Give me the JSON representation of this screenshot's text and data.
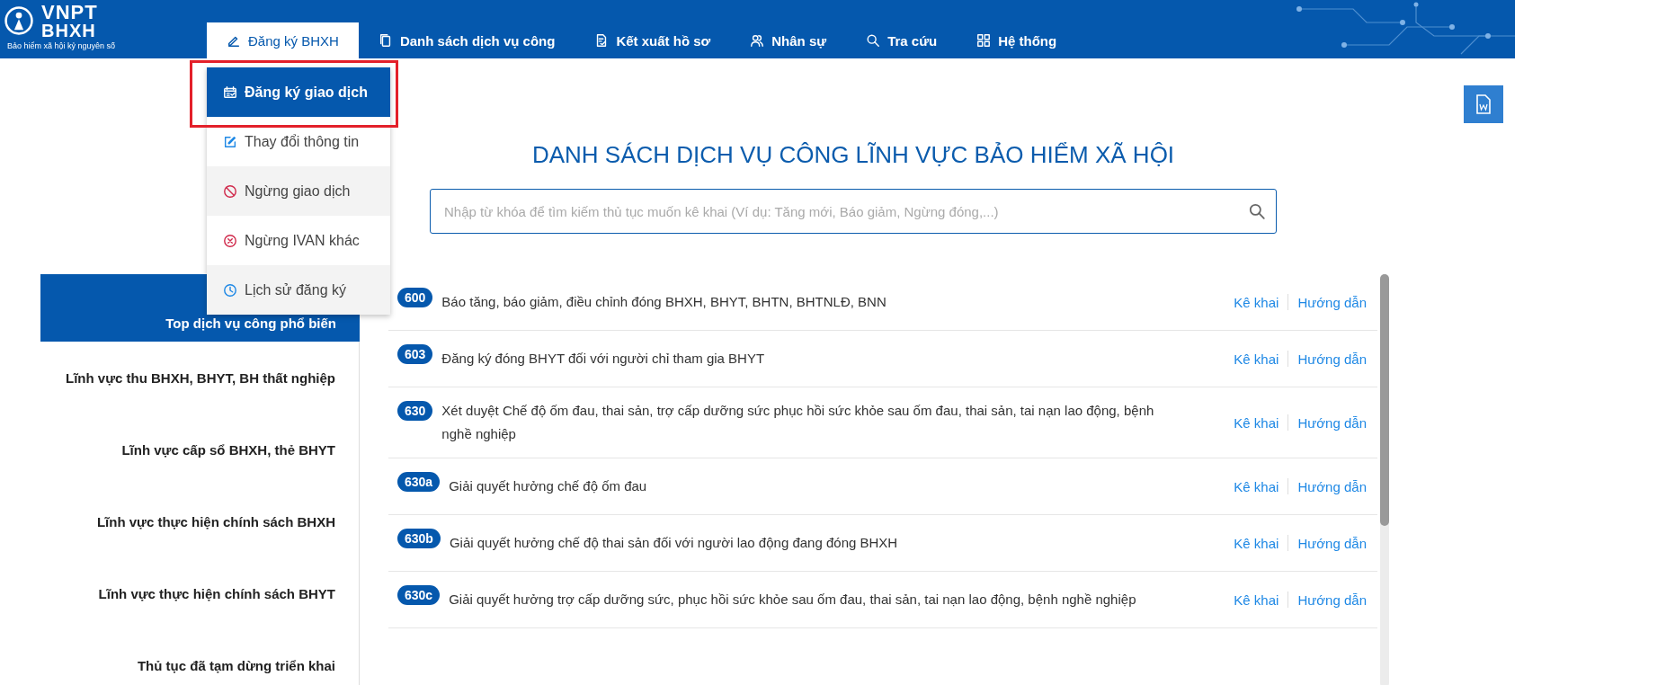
{
  "logo": {
    "brand": "VNPT",
    "product": "BHXH",
    "tagline": "Bảo hiểm xã hội kỷ nguyên số"
  },
  "nav": [
    {
      "label": "Đăng ký BHXH",
      "kind": "pencil",
      "selected": true
    },
    {
      "label": "Danh sách dịch vụ công",
      "kind": "copy",
      "selected": false
    },
    {
      "label": "Kết xuất hồ sơ",
      "kind": "file",
      "selected": false
    },
    {
      "label": "Nhân sự",
      "kind": "users",
      "selected": false
    },
    {
      "label": "Tra cứu",
      "kind": "search",
      "selected": false
    },
    {
      "label": "Hệ thống",
      "kind": "grid",
      "selected": false
    }
  ],
  "dropdown": [
    {
      "label": "Đăng ký giao dịch",
      "kind": "calendar",
      "selected": true,
      "highlighted": true
    },
    {
      "label": "Thay đổi thông tin",
      "kind": "edit",
      "selected": false,
      "highlighted": false
    },
    {
      "label": "Ngừng giao dịch",
      "kind": "ban",
      "selected": false,
      "highlighted": false
    },
    {
      "label": "Ngừng IVAN khác",
      "kind": "x-circle",
      "selected": false,
      "highlighted": false
    },
    {
      "label": "Lịch sử đăng ký",
      "kind": "clock",
      "selected": false,
      "highlighted": false
    }
  ],
  "title": "DANH SÁCH DỊCH VỤ CÔNG LĨNH VỰC BẢO HIỂM XÃ HỘI",
  "search": {
    "placeholder": "Nhập từ khóa để tìm kiếm thủ tục muốn kê khai (Ví dụ: Tăng mới, Báo giảm, Ngừng đóng,...)"
  },
  "sidebar": [
    {
      "label": "Top dịch vụ công phổ biến",
      "selected": true
    },
    {
      "label": "Lĩnh vực thu BHXH, BHYT, BH thất nghiệp",
      "selected": false
    },
    {
      "label": "Lĩnh vực cấp sổ BHXH, thẻ BHYT",
      "selected": false
    },
    {
      "label": "Lĩnh vực thực hiện chính sách BHXH",
      "selected": false
    },
    {
      "label": "Lĩnh vực thực hiện chính sách BHYT",
      "selected": false
    },
    {
      "label": "Thủ tục đã tạm dừng triển khai",
      "selected": false
    }
  ],
  "services": [
    {
      "code": "600",
      "name": "Báo tăng, báo giảm, điều chỉnh đóng BHXH, BHYT, BHTN, BHTNLĐ, BNN",
      "declare": "Kê khai",
      "guide": "Hướng dẫn"
    },
    {
      "code": "603",
      "name": "Đăng ký đóng BHYT đối với người chỉ tham gia BHYT",
      "declare": "Kê khai",
      "guide": "Hướng dẫn"
    },
    {
      "code": "630",
      "name": "Xét duyệt Chế độ ốm đau, thai sản, trợ cấp dưỡng sức phục hồi sức khỏe sau ốm đau, thai sản, tai nạn lao động, bệnh nghề nghiệp",
      "declare": "Kê khai",
      "guide": "Hướng dẫn"
    },
    {
      "code": "630a",
      "name": "Giải quyết hưởng chế độ ốm đau",
      "declare": "Kê khai",
      "guide": "Hướng dẫn"
    },
    {
      "code": "630b",
      "name": "Giải quyết hưởng chế độ thai sản đối với người lao động đang đóng BHXH",
      "declare": "Kê khai",
      "guide": "Hướng dẫn"
    },
    {
      "code": "630c",
      "name": "Giải quyết hưởng trợ cấp dưỡng sức, phục hồi sức khỏe sau ốm đau, thai sản, tai nạn lao động, bệnh nghề nghiệp",
      "declare": "Kê khai",
      "guide": "Hướng dẫn"
    }
  ]
}
